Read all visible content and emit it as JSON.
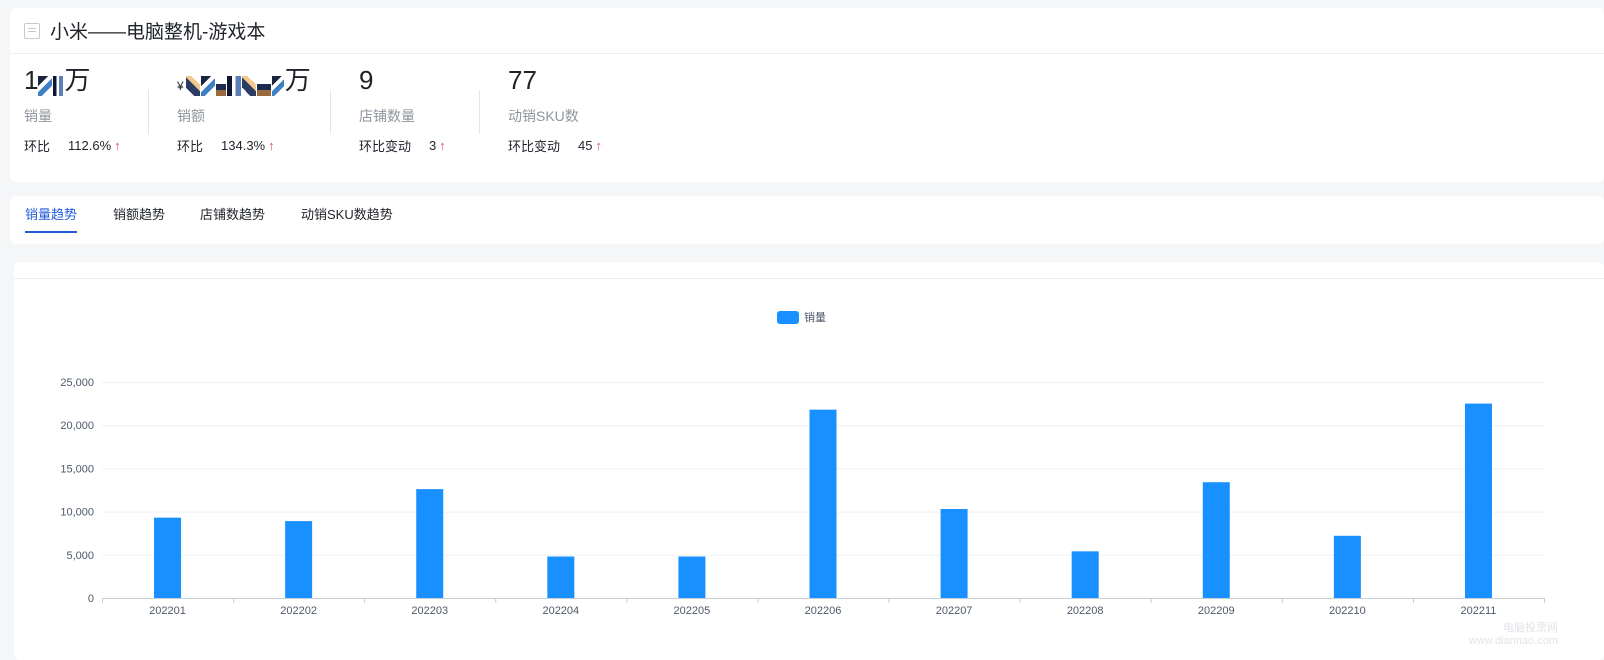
{
  "header": {
    "title": "小米——电脑整机-游戏本",
    "icon": "report-icon"
  },
  "metrics": [
    {
      "id": "sales-volume",
      "value_suffix": "万",
      "label": "销量",
      "compare_label": "环比",
      "compare_value": "112.6%",
      "trend": "up"
    },
    {
      "id": "sales-amount",
      "currency": "¥",
      "value_suffix": "万",
      "label": "销额",
      "compare_label": "环比",
      "compare_value": "134.3%",
      "trend": "up"
    },
    {
      "id": "store-count",
      "value": "9",
      "label": "店铺数量",
      "compare_label": "环比变动",
      "compare_value": "3",
      "trend": "up"
    },
    {
      "id": "active-sku",
      "value": "77",
      "label": "动销SKU数",
      "compare_label": "环比变动",
      "compare_value": "45",
      "trend": "up"
    }
  ],
  "tabs": [
    {
      "label": "销量趋势",
      "active": true
    },
    {
      "label": "销额趋势",
      "active": false
    },
    {
      "label": "店铺数趋势",
      "active": false
    },
    {
      "label": "动销SKU数趋势",
      "active": false
    }
  ],
  "colors": {
    "accent": "#245bdb",
    "bar": "#1890ff",
    "up": "#e34d59"
  },
  "chart_data": {
    "type": "bar",
    "categories": [
      "202201",
      "202202",
      "202203",
      "202204",
      "202205",
      "202206",
      "202207",
      "202208",
      "202209",
      "202210",
      "202211"
    ],
    "series": [
      {
        "name": "销量",
        "values": [
          9300,
          8900,
          12600,
          4800,
          4800,
          21800,
          10300,
          5400,
          13400,
          7200,
          22500
        ]
      }
    ],
    "ylim": [
      0,
      25000
    ],
    "yticks": [
      "0",
      "5,000",
      "10,000",
      "15,000",
      "20,000",
      "25,000"
    ],
    "legend_position": "top-center",
    "grid": true
  },
  "watermark": {
    "line1": "电脑投票网",
    "line2": "www.diannao.com"
  }
}
